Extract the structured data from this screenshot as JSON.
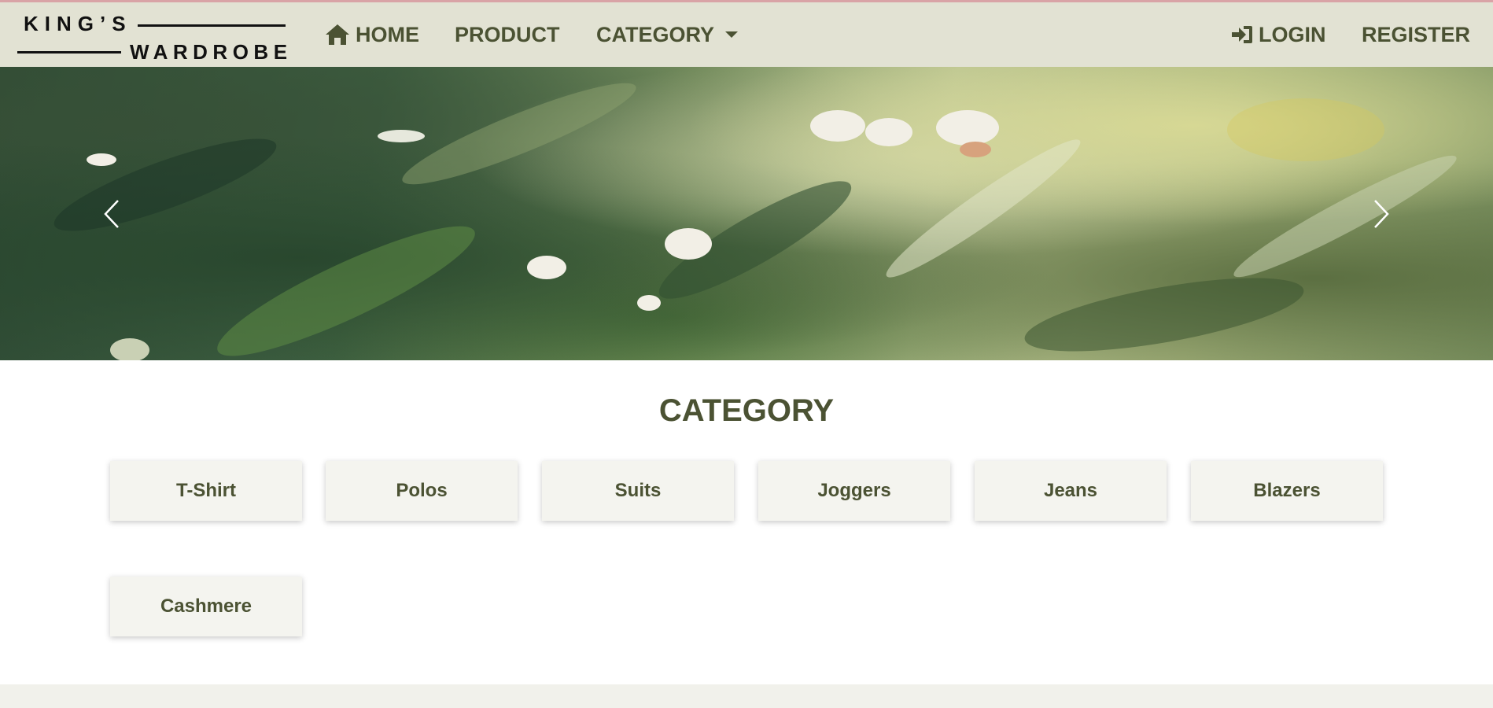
{
  "brand": {
    "line1": "KING’S",
    "line2": "WARDROBE"
  },
  "nav": {
    "home": "HOME",
    "product": "PRODUCT",
    "category": "CATEGORY",
    "login": "LOGIN",
    "register": "REGISTER"
  },
  "icons": {
    "home": "home-icon",
    "dropdown": "caret-down-icon",
    "login": "sign-in-icon",
    "prev": "chevron-left-icon",
    "next": "chevron-right-icon"
  },
  "section": {
    "title": "CATEGORY"
  },
  "categories": [
    "T-Shirt",
    "Polos",
    "Suits",
    "Joggers",
    "Jeans",
    "Blazers",
    "Cashmere"
  ],
  "colors": {
    "navbar_bg": "#e2e2d3",
    "text_primary": "#4b5233",
    "accent_top_line": "#d9a3a6",
    "category_card_bg": "#f4f4ef",
    "footer_band": "#f1f1eb"
  }
}
